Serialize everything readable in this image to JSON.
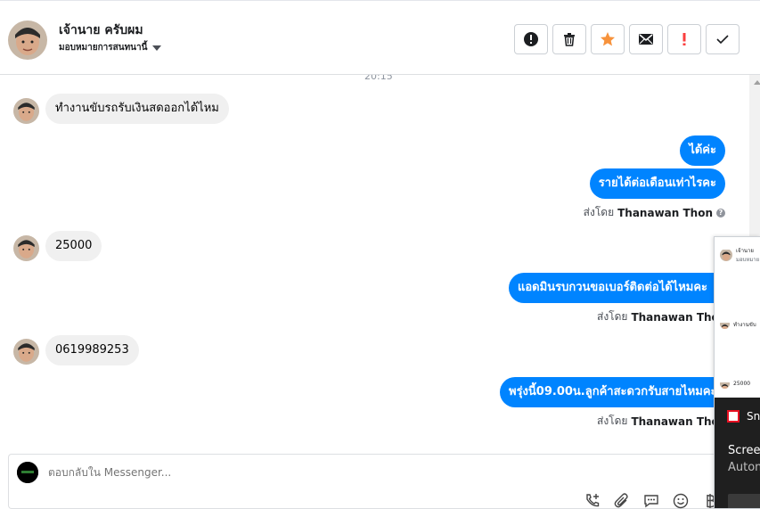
{
  "header": {
    "contact_name": "เจ้านาย ครับผม",
    "assign_label": "มอบหมายการสนทนานี้",
    "toolbar": [
      {
        "name": "report-button",
        "icon": "alert-circle-icon"
      },
      {
        "name": "delete-button",
        "icon": "trash-icon"
      },
      {
        "name": "star-button",
        "icon": "star-icon",
        "color": "#f7923b"
      },
      {
        "name": "mark-unread-button",
        "icon": "envelope-icon"
      },
      {
        "name": "spam-button",
        "icon": "exclamation-icon",
        "color": "#fa3e3e"
      },
      {
        "name": "done-button",
        "icon": "check-icon"
      }
    ]
  },
  "chat": {
    "timestamp": "20:15",
    "messages": [
      {
        "dir": "in",
        "text": "ทำงานขับรถรับเงินสดออกได้ไหม"
      },
      {
        "dir": "out",
        "text": "ได้ค่ะ"
      },
      {
        "dir": "out",
        "text": "รายได้ต่อเดือนเท่าไรคะ"
      },
      {
        "dir": "in",
        "text": "25000"
      },
      {
        "dir": "out",
        "text": "แอดมินรบกวนขอเบอร์ติดต่อได้ไหมคะ"
      },
      {
        "dir": "in",
        "text": "0619989253"
      },
      {
        "dir": "out",
        "text": "พรุ่งนี้09.00น.ลูกค้าสะดวกรับสายไหมคะ"
      }
    ],
    "sent_by_prefix": "ส่งโดย",
    "sent_by_name": "Thanawan Thon"
  },
  "composer": {
    "placeholder": "ตอบกลับใน Messenger..."
  },
  "overlay": {
    "preview_name": "เจ้านาย",
    "preview_sub": "มอบหมาย",
    "preview_msg1": "ทำงานขับ",
    "preview_msg2": "25000",
    "toast_app": "Sni",
    "toast_title": "Screen",
    "toast_sub": "Autom"
  },
  "colors": {
    "outgoing_bubble": "#0084ff",
    "incoming_bubble": "#f0f0f0",
    "star": "#f7923b",
    "spam": "#fa3e3e"
  }
}
